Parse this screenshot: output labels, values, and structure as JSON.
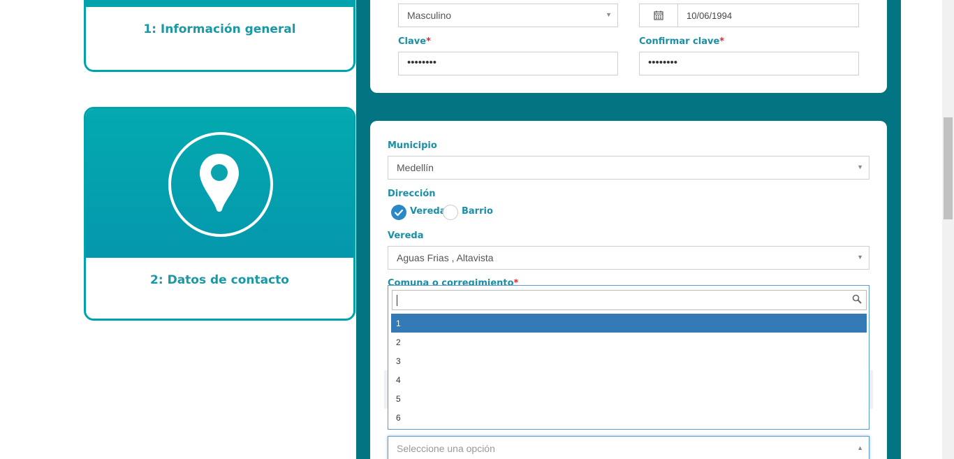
{
  "steps": [
    {
      "label": "1: Información general"
    },
    {
      "label": "2: Datos de contacto",
      "icon": "location-pin-icon"
    }
  ],
  "panel1": {
    "gender": "Masculino",
    "birthdate": "10/06/1994",
    "password_label": "Clave",
    "confirm_label": "Confirmar clave",
    "required_mark": "*",
    "password_value": "••••••••",
    "confirm_value": "••••••••"
  },
  "panel2": {
    "municipio_label": "Municipio",
    "municipio_value": "Medellín",
    "direccion_label": "Dirección",
    "radio_vereda": "Vereda",
    "radio_barrio": "Barrio",
    "vereda_label": "Vereda",
    "vereda_value": "Aguas Frias , Altavista",
    "comuna_label": "Comuna o corregimiento",
    "required_mark": "*",
    "bottom_placeholder": "Seleccione una opción"
  },
  "dropdown": {
    "options": [
      "1",
      "2",
      "3",
      "4",
      "5",
      "6"
    ],
    "selected": "1"
  },
  "colors": {
    "teal_bg": "#037482",
    "accent": "#00a3ad",
    "label": "#1a8fa6",
    "selected": "#337ab7"
  }
}
